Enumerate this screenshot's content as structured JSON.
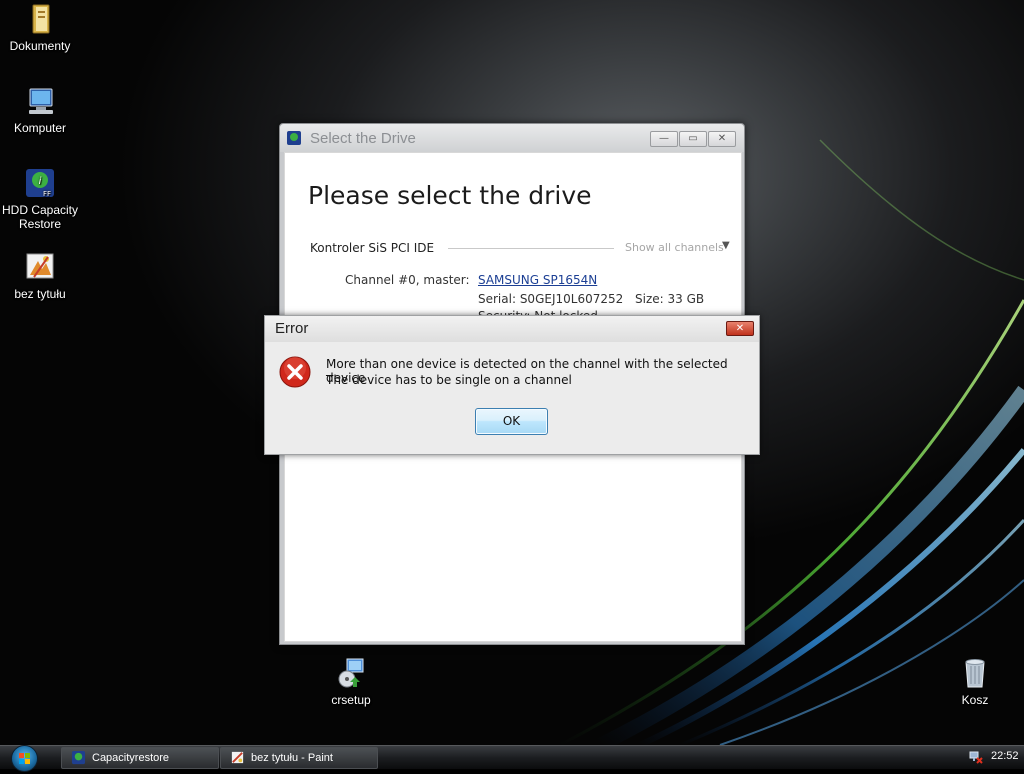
{
  "desktop": {
    "icons": [
      {
        "label": "Dokumenty",
        "icon": "folder-documents-icon"
      },
      {
        "label": "Komputer",
        "icon": "computer-icon"
      },
      {
        "label": "HDD Capacity Restore",
        "line1": "HDD Capacity",
        "line2": "Restore",
        "icon": "hdd-capacity-restore-icon"
      },
      {
        "label": "bez tytułu",
        "icon": "paint-image-icon"
      },
      {
        "label": "crsetup",
        "icon": "installer-icon"
      },
      {
        "label": "Kosz",
        "icon": "recycle-bin-icon"
      }
    ]
  },
  "main_window": {
    "title": "Select the Drive",
    "heading": "Please select the drive",
    "controller": "Kontroler SiS PCI IDE",
    "show_channels": "Show all channels",
    "channel_label": "Channel #0, master:",
    "drive_name": "SAMSUNG SP1654N",
    "serial": "Serial: S0GEJ10L607252",
    "size": "Size: 33 GB",
    "security": "Security: Not locked",
    "buttons": {
      "minimize": "—",
      "maximize": "▭",
      "close": "✕"
    }
  },
  "error_dialog": {
    "title": "Error",
    "message_line1": "More than one device is detected on the channel with the selected device",
    "message_line2": "The device has to be single on a channel",
    "ok_label": "OK",
    "close_label": "✕"
  },
  "taskbar": {
    "items": [
      {
        "label": "Capacityrestore",
        "icon": "capacityrestore-app-icon"
      },
      {
        "label": "bez tytułu - Paint",
        "icon": "paint-app-icon"
      }
    ],
    "clock": "22:52"
  },
  "colors": {
    "link": "#1c3f94",
    "ok_button": "#bee6fd",
    "error_close": "#c0321c"
  }
}
